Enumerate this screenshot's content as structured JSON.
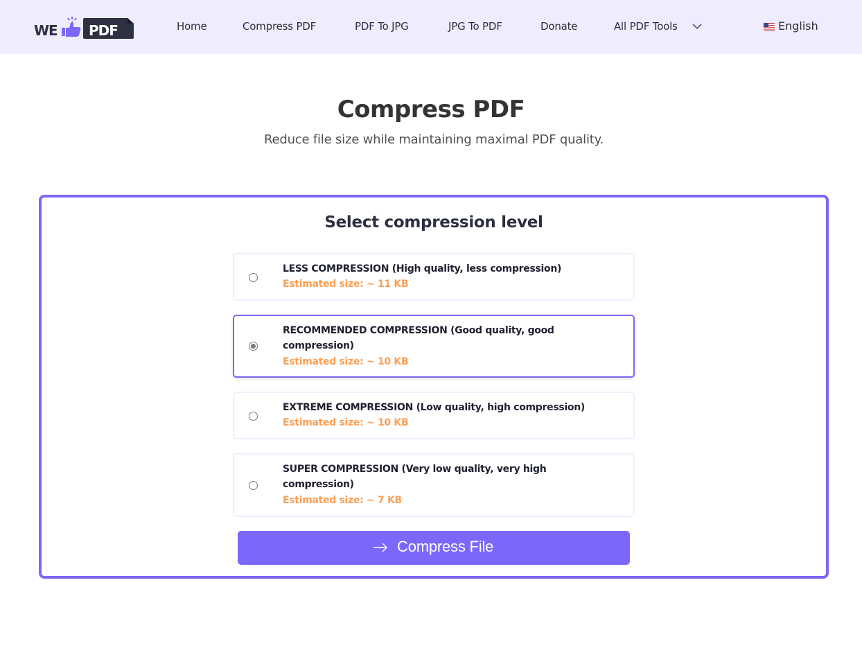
{
  "header": {
    "logo_text_left": "WE",
    "logo_text_right": "PDF",
    "nav": [
      {
        "label": "Home"
      },
      {
        "label": "Compress PDF"
      },
      {
        "label": "PDF To JPG"
      },
      {
        "label": "JPG To PDF"
      },
      {
        "label": "Donate"
      },
      {
        "label": "All PDF Tools"
      }
    ],
    "language": "English",
    "language_flag_icon": "us-flag-icon",
    "dropdown_icon": "chevron-down-icon"
  },
  "main": {
    "title": "Compress PDF",
    "subtitle": "Reduce file size while maintaining maximal PDF quality.",
    "panel_title": "Select compression level",
    "options": [
      {
        "label": "LESS COMPRESSION (High quality, less compression)",
        "estimate": "Estimated size: ~ 11 KB",
        "selected": false
      },
      {
        "label": "RECOMMENDED COMPRESSION (Good quality, good compression)",
        "estimate": "Estimated size: ~ 10 KB",
        "selected": true
      },
      {
        "label": "EXTREME COMPRESSION (Low quality, high compression)",
        "estimate": "Estimated size: ~ 10 KB",
        "selected": false
      },
      {
        "label": "SUPER COMPRESSION (Very low quality, very high compression)",
        "estimate": "Estimated size: ~ 7 KB",
        "selected": false
      }
    ],
    "submit_label": "Compress File",
    "submit_icon": "arrow-right-icon"
  },
  "colors": {
    "accent": "#7b68f5",
    "header_bg": "#efedfd",
    "estimate_text": "#fb9f55"
  }
}
